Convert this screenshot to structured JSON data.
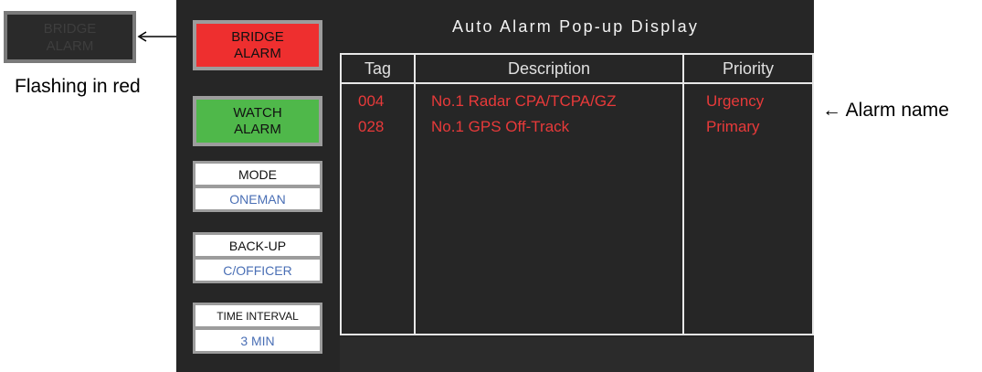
{
  "annotation": {
    "flash_button_lines": [
      "BRIDGE",
      "ALARM"
    ],
    "flash_text": "Flashing in red",
    "alarm_name_label": "← Alarm name"
  },
  "panel": {
    "bridge_alarm_lines": [
      "BRIDGE",
      "ALARM"
    ],
    "watch_alarm_lines": [
      "WATCH",
      "ALARM"
    ],
    "mode": {
      "label": "MODE",
      "value": "ONEMAN"
    },
    "backup": {
      "label": "BACK-UP",
      "value": "C/OFFICER"
    },
    "time_interval": {
      "label": "TIME INTERVAL",
      "value": "3 MIN"
    },
    "colors": {
      "bridge_alarm": "#ee2f2f",
      "watch_alarm": "#4fb84a",
      "value_text": "#4a6fb5"
    }
  },
  "display": {
    "title": "Auto Alarm Pop-up Display",
    "columns": [
      "Tag",
      "Description",
      "Priority"
    ],
    "rows": [
      {
        "tag": "004",
        "description": "No.1 Radar CPA/TCPA/GZ",
        "priority": "Urgency"
      },
      {
        "tag": "028",
        "description": "No.1 GPS Off-Track",
        "priority": "Primary"
      }
    ],
    "colors": {
      "background": "#262626",
      "alarm_text": "#e83a3a",
      "header_text": "#e0e0e0"
    }
  }
}
